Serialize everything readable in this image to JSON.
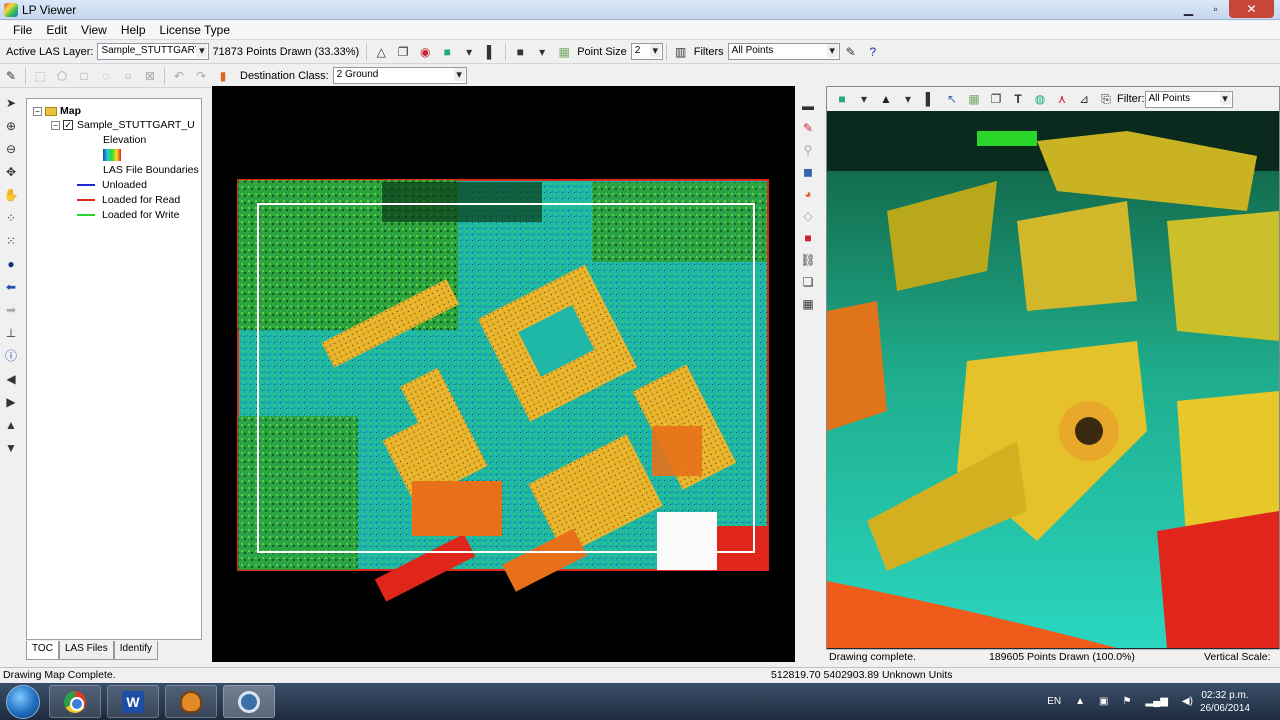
{
  "window": {
    "title": "LP Viewer"
  },
  "menu": [
    "File",
    "Edit",
    "View",
    "Help",
    "License Type"
  ],
  "toolbar1": {
    "active_layer_label": "Active LAS Layer:",
    "active_layer_value": "Sample_STUTTGART",
    "points_drawn": "71873 Points Drawn (33.33%)",
    "point_size_label": "Point Size",
    "point_size_value": "2",
    "filters_label": "Filters",
    "filters_value": "All Points"
  },
  "toolbar2": {
    "destination_class_label": "Destination Class:",
    "destination_class_value": "2  Ground"
  },
  "toc": {
    "root": "Map",
    "layer": "Sample_STUTTGART_U",
    "elevation": "Elevation",
    "boundaries": "LAS File Boundaries",
    "legend": [
      {
        "label": "Unloaded",
        "color": "#1a2bd6"
      },
      {
        "label": "Loaded for Read",
        "color": "#e0261a"
      },
      {
        "label": "Loaded for Write",
        "color": "#2ad62a"
      }
    ],
    "tabs": [
      "TOC",
      "LAS Files",
      "Identify"
    ]
  },
  "view3d": {
    "filter_label": "Filter:",
    "filter_value": "All Points",
    "status_left": "Drawing complete.",
    "status_mid": "189605 Points Drawn (100.0%)",
    "status_right": "Vertical Scale:"
  },
  "statusbar": {
    "left": "Drawing Map Complete.",
    "coords": "512819.70 5402903.89 Unknown Units"
  },
  "taskbar": {
    "lang": "EN",
    "time": "02:32 p.m.",
    "date": "26/06/2014"
  }
}
